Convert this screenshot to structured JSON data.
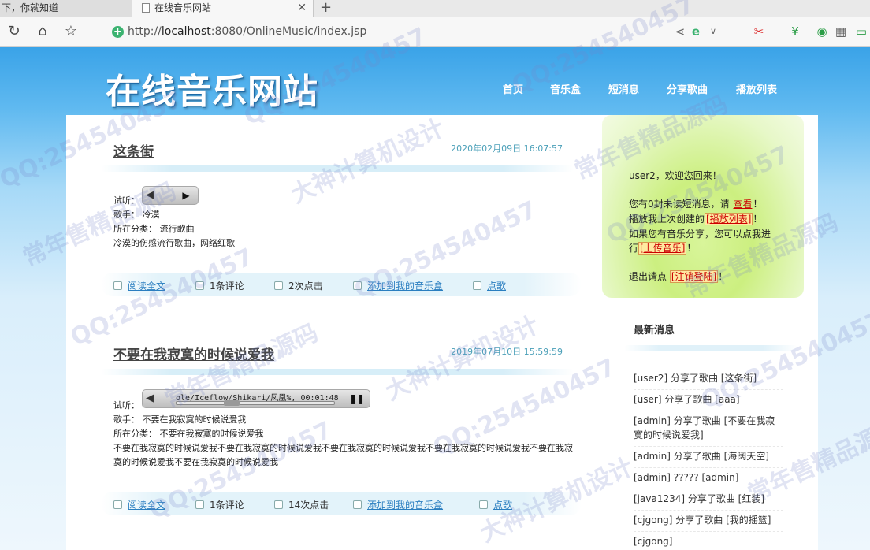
{
  "browser": {
    "prev_tab_title": "下，你就知道",
    "active_tab_title": "在线音乐网站",
    "url_prefix": "http://",
    "url_host": "localhost",
    "url_rest": ":8080/OnlineMusic/index.jsp"
  },
  "site": {
    "logo": "在线音乐网站",
    "nav": [
      "首页",
      "音乐盒",
      "短消息",
      "分享歌曲",
      "播放列表"
    ]
  },
  "posts": [
    {
      "title": "这条街",
      "date": "2020年02月09日 16:07:57",
      "preview_label": "试听：",
      "singer_line": "歌手： 冷漠",
      "category_line": "所在分类： 流行歌曲",
      "description": "冷漠的伤感流行歌曲，网络红歌",
      "player_text": "",
      "read_more": "阅读全文",
      "comments": "1条评论",
      "clicks": "2次点击",
      "add_to_box": "添加到我的音乐盒",
      "request": "点歌"
    },
    {
      "title": "不要在我寂寞的时候说爱我",
      "date": "2019年07月10日 15:59:59",
      "preview_label": "试听：",
      "singer_line": "歌手： 不要在我寂寞的时候说爱我",
      "category_line": "所在分类： 不要在我寂寞的时候说爱我",
      "description": "不要在我寂寞的时候说爱我不要在我寂寞的时候说爱我不要在我寂寞的时候说爱我不要在我寂寞的时候说爱我不要在我寂寞的时候说爱我不要在我寂寞的时候说爱我",
      "player_text": "ole/Iceflow/Shikari/凤凰%,  00:01:48",
      "read_more": "阅读全文",
      "comments": "1条评论",
      "clicks": "14次点击",
      "add_to_box": "添加到我的音乐盒",
      "request": "点歌"
    }
  ],
  "sidebar": {
    "welcome": "user2，欢迎您回来！",
    "unread_pre": "您有0封未读短消息，请",
    "unread_link": "查看",
    "unread_post": "！",
    "playlist_pre": "播放我上次创建的",
    "playlist_link": "[播放列表]",
    "playlist_post": "！",
    "share_line1": "如果您有音乐分享，您可以点我进",
    "share_pre": "行",
    "share_link": "[上传音乐]",
    "share_post": "！",
    "logout_pre": "退出请点",
    "logout_link": "[注销登陆]",
    "logout_post": "！",
    "news_title": "最新消息",
    "news": [
      "[user2] 分享了歌曲 [这条街]",
      "[user] 分享了歌曲 [aaa]",
      "[admin]  分享了歌曲  [不要在我寂寞的时候说爱我]",
      "[admin] 分享了歌曲 [海阔天空]",
      "[admin] ????? [admin]",
      "[java1234] 分享了歌曲 [红装]",
      "[cjgong] 分享了歌曲 [我的摇篮]",
      "[cjgong]"
    ]
  },
  "watermarks": [
    "QQ:254540457",
    "大神计算机设计",
    "常年售精品源码"
  ],
  "colors": {
    "header_blue": "#3aa3e8",
    "link_blue": "#2a7ec0",
    "side_green": "#ccef80"
  }
}
